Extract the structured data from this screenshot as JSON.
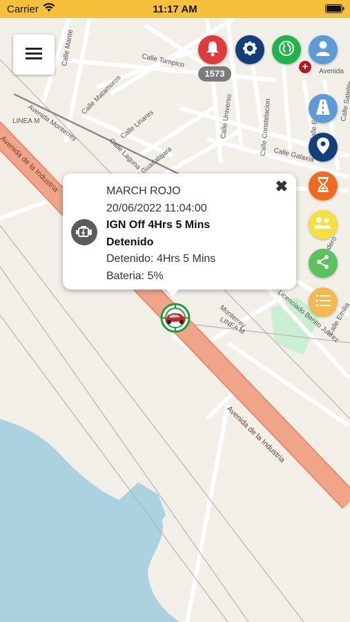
{
  "status_bar": {
    "carrier": "Carrier",
    "time": "11:17 AM"
  },
  "map": {
    "streets": [
      "Calle Tampico",
      "Calle Matamoros",
      "Calle Linares",
      "Calle Laguna",
      "Calle Guadalajara",
      "Avenida Monterrey",
      "LINEA M",
      "Avenida de la Industria",
      "Calle Constelacion",
      "Calle Estrella",
      "Calle Galaxia",
      "Calle Universo",
      "Avenida",
      "Calle Satelite",
      "Calle Mante",
      "Calle Madero",
      "Calle Emilia",
      "Licenciado Benito Juárez",
      "Monterrey"
    ],
    "colors": {
      "land": "#f2efe9",
      "water": "#aad3df",
      "park": "#c8f0d0",
      "highway": "#f0a488",
      "highway_outline": "#e58a6e",
      "street": "#ffffff",
      "railway": "#9a9a9a"
    }
  },
  "toolbar": {
    "menu_icon": "hamburger-menu-icon",
    "alert_count": "1573",
    "plus": "+",
    "buttons": [
      {
        "name": "alerts-bell-button",
        "icon": "bell-icon",
        "color": "#e23a3a"
      },
      {
        "name": "settings-button",
        "icon": "gear-icon",
        "color": "#123f7a"
      },
      {
        "name": "globe-button",
        "icon": "globe-icon",
        "color": "#1eb54a"
      },
      {
        "name": "profile-button",
        "icon": "user-icon",
        "color": "#5b9bd8"
      },
      {
        "name": "road-button",
        "icon": "road-icon",
        "color": "#5b9bd8"
      },
      {
        "name": "location-button",
        "icon": "location-pin-icon",
        "color": "#123f7a"
      },
      {
        "name": "history-button",
        "icon": "hourglass-icon",
        "color": "#f26a1b"
      },
      {
        "name": "contacts-button",
        "icon": "users-icon",
        "color": "#f5e13b"
      },
      {
        "name": "share-button",
        "icon": "share-icon",
        "color": "#5cc35c"
      },
      {
        "name": "list-button",
        "icon": "list-icon",
        "color": "#f7b84b"
      }
    ]
  },
  "popup": {
    "vehicle_name": "MARCH ROJO",
    "datetime": "20/06/2022 11:04:00",
    "ignition_status": "IGN Off 4Hrs 5 Mins",
    "state": "Detenido",
    "stopped_time": "Detenido: 4Hrs 5 Mins",
    "battery": "Bateria: 5%",
    "close_symbol": "✖",
    "status_icon": "engine-icon"
  }
}
